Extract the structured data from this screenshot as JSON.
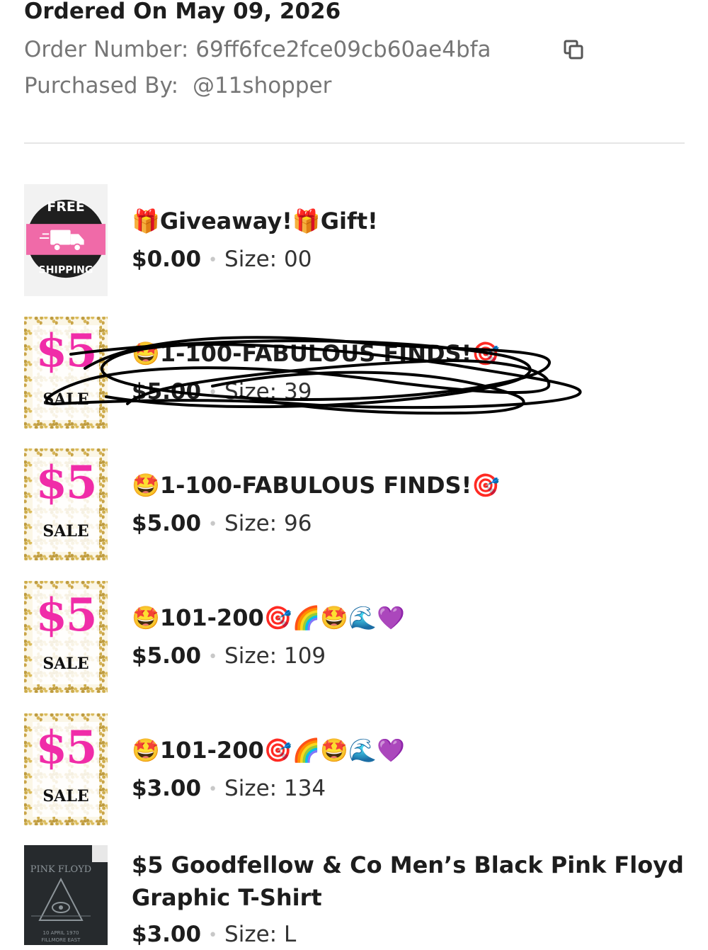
{
  "header": {
    "ordered_on": "Ordered On May 09, 2026",
    "order_number_label": "Order Number:",
    "order_number_value": "69ff6fce2fce09cb60ae4bfa",
    "purchased_by_label": "Purchased By:",
    "purchased_by_value": "@11shopper"
  },
  "items": [
    {
      "title": "🎁Giveaway!🎁Gift!",
      "price": "$0.00",
      "size": "Size: 00",
      "thumb": "free-shipping",
      "thumb_text_top": "FREE",
      "thumb_text_bottom": "SHIPPING"
    },
    {
      "title": "🤩1-100-FABULOUS FINDS!🎯",
      "price": "$5.00",
      "size": "Size: 39",
      "thumb": "five-dollar-sale",
      "thumb_big": "$5",
      "thumb_word": "SALE",
      "scribbled_out": true
    },
    {
      "title": "🤩1-100-FABULOUS FINDS!🎯",
      "price": "$5.00",
      "size": "Size: 96",
      "thumb": "five-dollar-sale",
      "thumb_big": "$5",
      "thumb_word": "SALE"
    },
    {
      "title": "🤩101-200🎯🌈🤩🌊💜",
      "price": "$5.00",
      "size": "Size: 109",
      "thumb": "five-dollar-sale",
      "thumb_big": "$5",
      "thumb_word": "SALE"
    },
    {
      "title": "🤩101-200🎯🌈🤩🌊💜",
      "price": "$3.00",
      "size": "Size: 134",
      "thumb": "five-dollar-sale",
      "thumb_big": "$5",
      "thumb_word": "SALE"
    },
    {
      "title_line1": "$5 Goodfellow & Co Men’s Black Pink Floyd",
      "title_line2": "Graphic T-Shirt",
      "price": "$3.00",
      "size": "Size: L",
      "thumb": "black-tshirt",
      "shirt_text_top": "PINK FLOYD",
      "shirt_text_bottom1": "10 APRIL 1970",
      "shirt_text_bottom2": "FILLMORE EAST"
    }
  ],
  "colors": {
    "sale_pink": "#f02ca8",
    "muted_text": "#767676",
    "divider": "#e6e6e6",
    "shipping_pink": "#f06aa8"
  },
  "icons": {
    "copy": "copy-icon",
    "truck": "truck-icon"
  }
}
